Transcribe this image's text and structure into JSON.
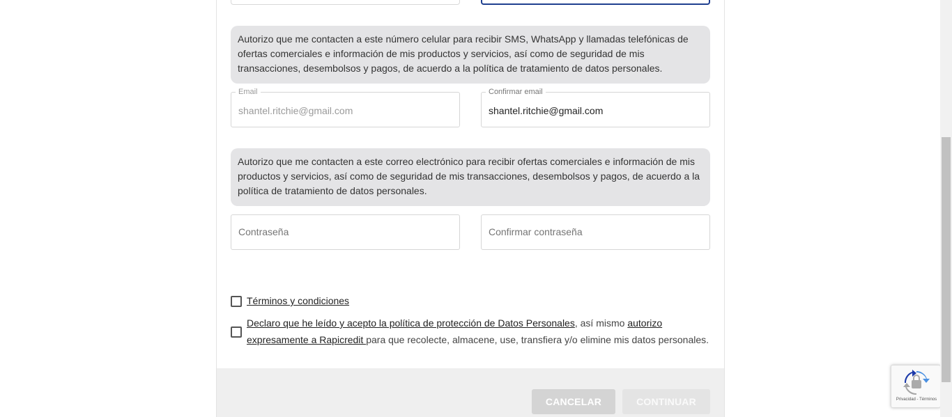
{
  "phone_notice": "Autorizo que me contacten a este número celular para recibir SMS, WhatsApp y llamadas telefónicas de ofertas comerciales e información de mis productos y servicios, así como de seguridad de mis transacciones, desembolsos y pagos, de acuerdo a la política de tratamiento de datos personales.",
  "email": {
    "label": "Email",
    "value": "shantel.ritchie@gmail.com"
  },
  "confirm_email": {
    "label": "Confirmar email",
    "value": "shantel.ritchie@gmail.com"
  },
  "email_notice": "Autorizo que me contacten a este correo electrónico para recibir ofertas comerciales e información de mis productos y servicios, así como de seguridad de mis transacciones, desembolsos y pagos, de acuerdo a la política de tratamiento de datos personales.",
  "password": {
    "placeholder": "Contraseña"
  },
  "confirm_password": {
    "placeholder": "Confirmar contraseña"
  },
  "terms": {
    "link": " Términos y condiciones ",
    "checked": false
  },
  "privacy": {
    "link1": " Declaro que he leído y acepto la política de protección de Datos Personales",
    "middle": ", así mismo ",
    "link2_line1": "autorizo ",
    "link2_line2": "expresamente a Rapicredit ",
    "end": "para que recolecte, almacene, use, transfiera y/o elimine mis datos personales.",
    "checked": false
  },
  "buttons": {
    "cancel": "CANCELAR",
    "continue": "CONTINUAR"
  },
  "recaptcha": {
    "links": "Privacidad - Términos"
  },
  "colors": {
    "notice_bg": "#e4e4e6",
    "focused_border": "#1f3f8f",
    "footer_bg": "#efefef",
    "button_disabled": "#d4d4d4"
  }
}
